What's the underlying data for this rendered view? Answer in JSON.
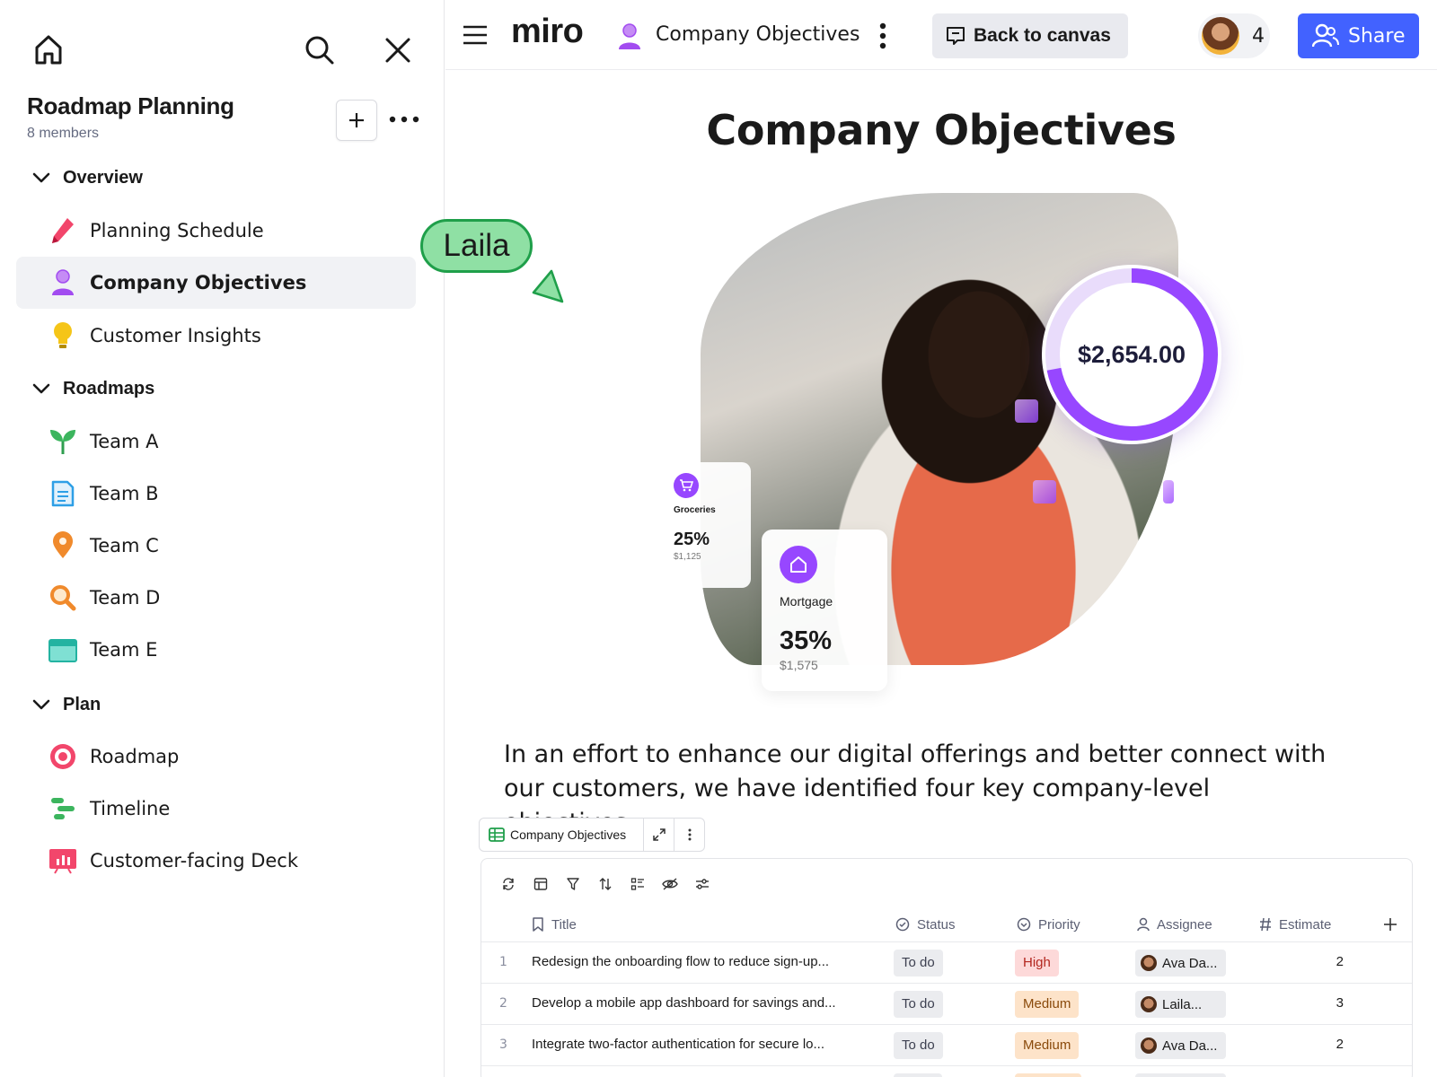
{
  "sidebar": {
    "board_name": "Roadmap Planning",
    "members": "8 members",
    "sections": [
      {
        "label": "Overview",
        "items": [
          {
            "label": "Planning Schedule",
            "icon": "pencil-icon",
            "color": "#f2466b"
          },
          {
            "label": "Company Objectives",
            "icon": "user-icon",
            "color": "#a24cf0",
            "active": true
          },
          {
            "label": "Customer Insights",
            "icon": "lightbulb-icon",
            "color": "#f5c518"
          }
        ]
      },
      {
        "label": "Roadmaps",
        "items": [
          {
            "label": "Team A",
            "icon": "sprout-icon",
            "color": "#3cb55e"
          },
          {
            "label": "Team B",
            "icon": "document-icon",
            "color": "#2e9fe6"
          },
          {
            "label": "Team C",
            "icon": "map-pin-icon",
            "color": "#f08a2c"
          },
          {
            "label": "Team D",
            "icon": "magnifier-icon",
            "color": "#f08a2c"
          },
          {
            "label": "Team E",
            "icon": "calendar-icon",
            "color": "#2ec7b5"
          }
        ]
      },
      {
        "label": "Plan",
        "items": [
          {
            "label": "Roadmap",
            "icon": "target-icon",
            "color": "#f2466b"
          },
          {
            "label": "Timeline",
            "icon": "gantt-icon",
            "color": "#3cb55e"
          },
          {
            "label": "Customer-facing Deck",
            "icon": "presentation-icon",
            "color": "#f2466b"
          }
        ]
      }
    ]
  },
  "topbar": {
    "logo": "miro",
    "doc_title": "Company Objectives",
    "back_label": "Back to canvas",
    "collaborator_count": "4",
    "share_label": "Share",
    "share_color": "#4262ff"
  },
  "content": {
    "heading": "Company Objectives",
    "hero": {
      "donut_value": "$2,654.00",
      "donut_fraction": 0.72,
      "groceries": {
        "label": "Groceries",
        "pct": "25%",
        "amount": "$1,125"
      },
      "mortgage": {
        "label": "Mortgage",
        "pct": "35%",
        "amount": "$1,575"
      }
    },
    "cursor_name": "Laila",
    "intro": "In an effort to enhance our digital offerings and better connect with our customers, we have identified four key company-level objectives."
  },
  "table": {
    "chip_label": "Company Objectives",
    "columns": [
      "Title",
      "Status",
      "Priority",
      "Assignee",
      "Estimate"
    ],
    "rows": [
      {
        "num": "1",
        "title": "Redesign the onboarding flow to reduce sign-up...",
        "status": "To do",
        "priority": "High",
        "priority_bg": "#fdd9d9",
        "priority_fg": "#b3261e",
        "assignee": "Ava Da...",
        "estimate": "2"
      },
      {
        "num": "2",
        "title": "Develop a mobile app dashboard for savings and...",
        "status": "To do",
        "priority": "Medium",
        "priority_bg": "#fde3c9",
        "priority_fg": "#8a4a0b",
        "assignee": "Laila...",
        "estimate": "3"
      },
      {
        "num": "3",
        "title": "Integrate two-factor authentication for secure lo...",
        "status": "To do",
        "priority": "Medium",
        "priority_bg": "#fde3c9",
        "priority_fg": "#8a4a0b",
        "assignee": "Ava Da...",
        "estimate": "2"
      }
    ]
  }
}
